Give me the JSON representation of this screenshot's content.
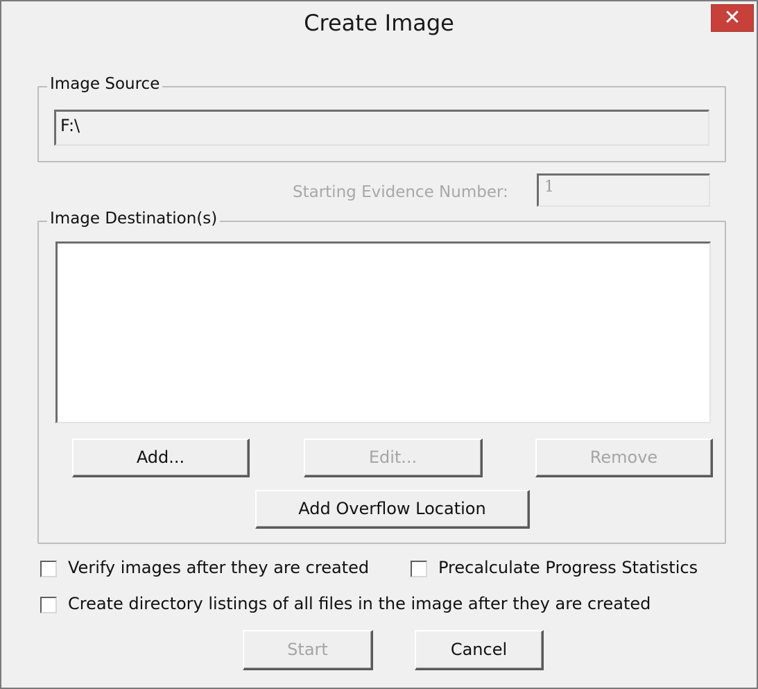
{
  "window": {
    "title": "Create Image",
    "close_glyph": "✕"
  },
  "image_source": {
    "group_label": "Image Source",
    "value": "F:\\"
  },
  "evidence": {
    "label": "Starting Evidence Number:",
    "value": "1"
  },
  "image_destinations": {
    "group_label": "Image Destination(s)",
    "items": [],
    "buttons": {
      "add": "Add...",
      "edit": "Edit...",
      "remove": "Remove",
      "add_overflow": "Add Overflow Location"
    }
  },
  "options": {
    "verify": {
      "label": "Verify images after they are created",
      "checked": false
    },
    "precalc": {
      "label": "Precalculate Progress Statistics",
      "checked": false
    },
    "dir_listings": {
      "label": "Create directory listings of all files in the image after they are created",
      "checked": false
    }
  },
  "footer": {
    "start": "Start",
    "cancel": "Cancel"
  },
  "colors": {
    "dialog_bg": "#f0f0f0",
    "close_button": "#c7403a",
    "disabled_text": "#a5a5a5"
  }
}
